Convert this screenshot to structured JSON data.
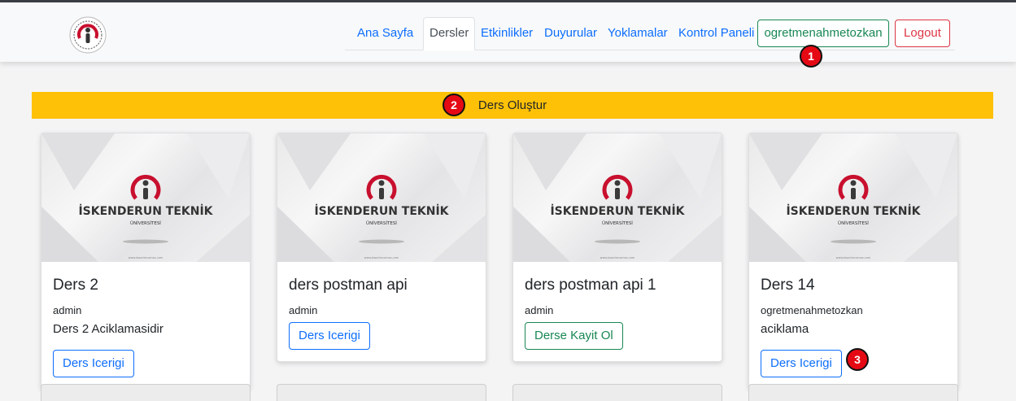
{
  "nav": {
    "links": [
      {
        "label": "Ana Sayfa"
      },
      {
        "label": "Dersler",
        "active": true
      },
      {
        "label": "Etkinlikler"
      },
      {
        "label": "Duyurular"
      },
      {
        "label": "Yoklamalar"
      },
      {
        "label": "Kontrol Paneli"
      }
    ],
    "user_button": "ogretmenahmetozkan",
    "logout_button": "Logout"
  },
  "create_course_button": "Ders Oluştur",
  "markers": [
    "1",
    "2",
    "3"
  ],
  "brand": {
    "name": "İSKENDERUN TEKNİK",
    "sub": "ÜNİVERSİTESİ",
    "website": "www.tasarimcamas.com",
    "accent_color": "#c8102e"
  },
  "cards": [
    {
      "title": "Ders 2",
      "author": "admin",
      "description": "Ders 2 Aciklamasidir",
      "button": "Ders Icerigi"
    },
    {
      "title": "ders postman api",
      "author": "admin",
      "description": "",
      "button": "Ders Icerigi"
    },
    {
      "title": "ders postman api 1",
      "author": "admin",
      "description": "",
      "button": "Derse Kayit Ol"
    },
    {
      "title": "Ders 14",
      "author": "ogretmenahmetozkan",
      "description": "aciklama",
      "button": "Ders Icerigi"
    }
  ],
  "colors": {
    "primary": "#0d6efd",
    "success": "#198754",
    "danger": "#dc3545",
    "warning": "#ffc107"
  }
}
